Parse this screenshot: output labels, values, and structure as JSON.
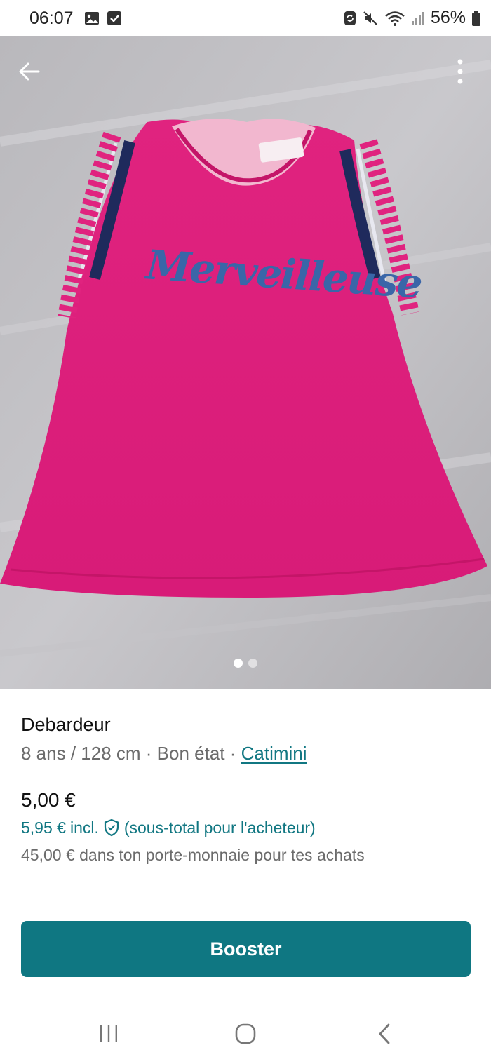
{
  "status_bar": {
    "time": "06:07",
    "battery": "56%",
    "icons": [
      "image-icon",
      "checkbox-icon",
      "sync-icon",
      "mute-icon",
      "wifi-icon",
      "signal-icon",
      "battery-icon"
    ]
  },
  "photo": {
    "printed_text": "Merveilleuse",
    "page_count": 2,
    "active_page": 1
  },
  "listing": {
    "title": "Debardeur",
    "size": "8 ans / 128 cm",
    "separator": " · ",
    "condition": "Bon état",
    "brand": "Catimini",
    "price": "5,00 €",
    "buyer_price": "5,95 €",
    "buyer_incl": "incl.",
    "buyer_note": "(sous-total pour l'acheteur)",
    "wallet_note": "45,00 € dans ton porte-monnaie pour tes achats"
  },
  "actions": {
    "booster_label": "Booster"
  },
  "colors": {
    "accent": "#0f7782",
    "link": "#117782",
    "garment": "#e0237f"
  }
}
